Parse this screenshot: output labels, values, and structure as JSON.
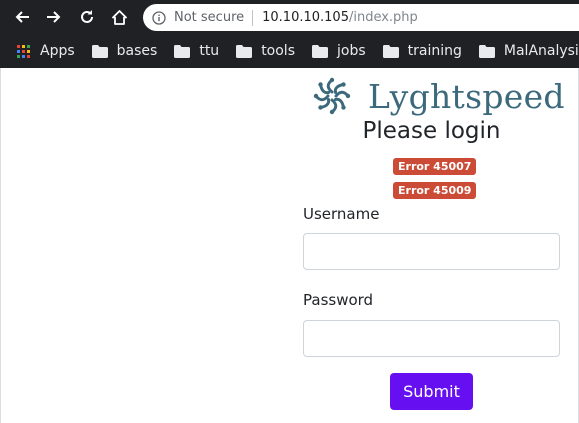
{
  "browser": {
    "security_label": "Not secure",
    "url_host": "10.10.10.105",
    "url_path": "/index.php",
    "bookmarks": [
      {
        "label": "Apps",
        "icon": "apps-grid-icon"
      },
      {
        "label": "bases",
        "icon": "folder-icon"
      },
      {
        "label": "ttu",
        "icon": "folder-icon"
      },
      {
        "label": "tools",
        "icon": "folder-icon"
      },
      {
        "label": "jobs",
        "icon": "folder-icon"
      },
      {
        "label": "training",
        "icon": "folder-icon"
      },
      {
        "label": "MalAnalysis",
        "icon": "folder-icon"
      }
    ]
  },
  "page": {
    "brand_name": "Lyghtspeed",
    "title": "Please login",
    "errors": [
      "Error 45007",
      "Error 45009"
    ],
    "username_label": "Username",
    "username_value": "",
    "password_label": "Password",
    "password_value": "",
    "submit_label": "Submit"
  },
  "colors": {
    "brand": "#3c6a7c",
    "error_badge": "#cc4b37",
    "submit": "#6610f2"
  }
}
